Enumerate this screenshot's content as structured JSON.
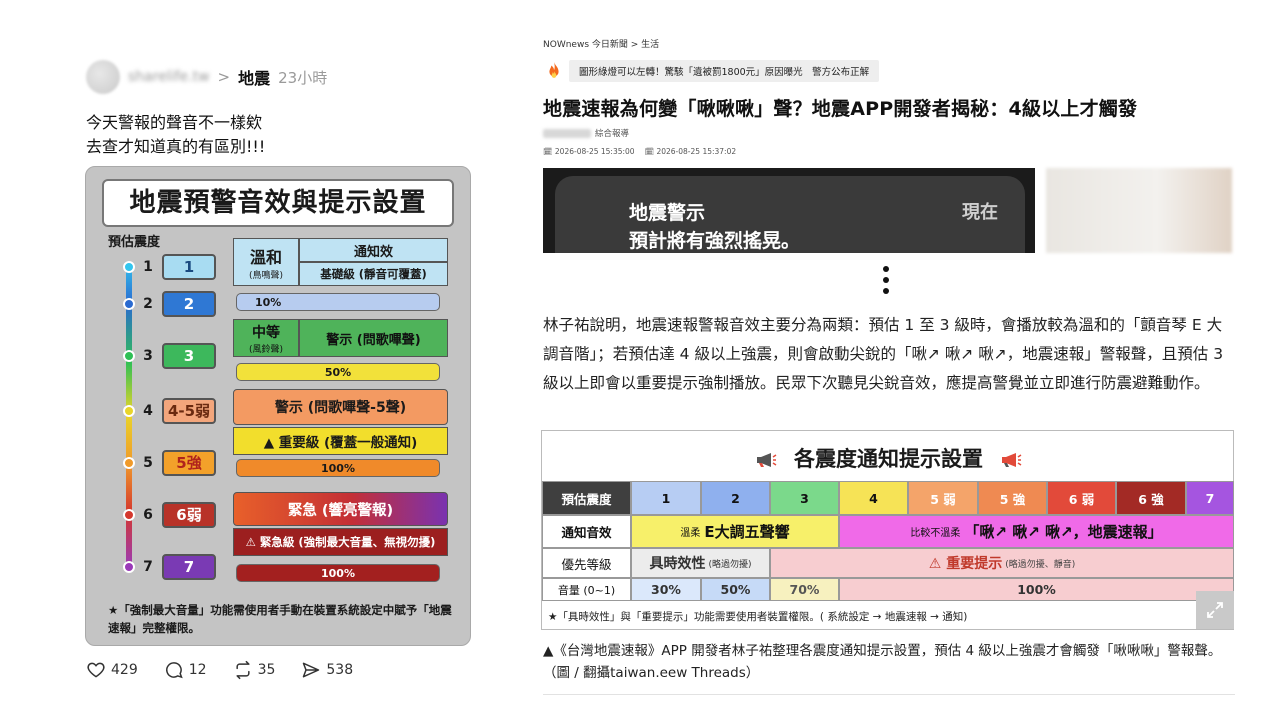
{
  "post": {
    "handle": "sharelife.tw",
    "separator": ">",
    "topic": "地震",
    "time_ago": "23小時",
    "text_line1": "今天警報的聲音不一樣欸",
    "text_line2": "去查才知道真的有區別!!!",
    "image": {
      "title": "地震預警音效與提示設置",
      "level_header": "預估震度",
      "levels": [
        {
          "num": "1",
          "label": "1",
          "color": "#a8dcf2",
          "text_color": "#1a4a80"
        },
        {
          "num": "2",
          "label": "2",
          "color": "#2f78d4",
          "text_color": "#ffffff"
        },
        {
          "num": "3",
          "label": "3",
          "color": "#3db85c",
          "text_color": "#ffffff"
        },
        {
          "num": "4",
          "label": "4-5弱",
          "color": "#f3a67c",
          "text_color": "#6a2a10"
        },
        {
          "num": "5",
          "label": "5強",
          "color": "#f3a12a",
          "text_color": "#b0231c"
        },
        {
          "num": "6",
          "label": "6弱",
          "color": "#b83228",
          "text_color": "#ffffff"
        },
        {
          "num": "7",
          "label": "7",
          "color": "#7a3ab4",
          "text_color": "#ffffff"
        }
      ],
      "gentle_label": "溫和",
      "gentle_sub": "(鳥鳴聲)",
      "notify_label": "通知效",
      "basic_level": "基礎級 (靜音可覆蓋)",
      "vol_10": "10%",
      "medium_label": "中等",
      "medium_sub": "(風鈴聲)",
      "warn_label": "警示 (問歌嗶聲)",
      "vol_50": "50%",
      "warn5_label": "警示 (問歌嗶聲-5聲)",
      "important_label": "▲ 重要級 (覆蓋一般通知)",
      "vol_100a": "100%",
      "urgent_label": "緊急 (響亮警報)",
      "urgent_level": "⚠ 緊急級 (強制最大音量、無視勿擾)",
      "vol_100b": "100%",
      "note": "★「強制最大音量」功能需使用者手動在裝置系統設定中賦予「地震速報」完整權限。"
    },
    "stats": {
      "likes": "429",
      "comments": "12",
      "reposts": "35",
      "shares": "538"
    }
  },
  "article": {
    "breadcrumb": "NOWnews 今日新聞 > 生活",
    "trending": "圖形綠燈可以左轉！驚駭「遺被罰1800元」原因曝光　警方公布正解",
    "headline": "地震速報為何變「啾啾啾」聲？地震APP開發者揭秘：4級以上才觸發",
    "author_role": "綜合報導",
    "published": "2026-08-25 15:35:00",
    "updated": "2026-08-25 15:37:02",
    "hero": {
      "line1": "地震警示",
      "line2": "預計將有強烈搖晃。",
      "now": "現在"
    },
    "body": "林子祐說明，地震速報警報音效主要分為兩類：預估 1 至 3 級時，會播放較為溫和的「顫音琴 E 大調音階」；若預估達 4 級以上強震，則會啟動尖銳的「啾↗ 啾↗ 啾↗，地震速報」警報聲，且預估 3 級以上即會以重要提示強制播放。民眾下次聽見尖銳音效，應提高警覺並立即進行防震避難動作。",
    "table": {
      "title": "各震度通知提示設置",
      "row_labels": [
        "預估震度",
        "通知音效",
        "優先等級",
        "音量 (0~1)"
      ],
      "levels": [
        {
          "label": "1",
          "color": "#b7cdf3"
        },
        {
          "label": "2",
          "color": "#8fb0ee"
        },
        {
          "label": "3",
          "color": "#7bd98b"
        },
        {
          "label": "4",
          "color": "#f6e356"
        },
        {
          "label": "5 弱",
          "color": "#f4a46a"
        },
        {
          "label": "5 強",
          "color": "#ef8a52"
        },
        {
          "label": "6 弱",
          "color": "#e24a3a"
        },
        {
          "label": "6 強",
          "color": "#a32a25"
        },
        {
          "label": "7",
          "color": "#a555e0"
        }
      ],
      "sound_gentle_prefix": "溫柔",
      "sound_gentle": "E大調五聲響",
      "sound_sharp_prefix": "比較不溫柔",
      "sound_sharp": "「啾↗ 啾↗ 啾↗，地震速報」",
      "priority_timely": "具時效性",
      "priority_timely_sub": "(略過勿擾)",
      "priority_important": "⚠ 重要提示",
      "priority_important_sub": "(略過勿擾、靜音)",
      "vol_30": "30%",
      "vol_50": "50%",
      "vol_70": "70%",
      "vol_100": "100%",
      "note": "★「具時效性」與「重要提示」功能需要使用者裝置權限。( 系統設定 → 地震速報 → 通知)"
    },
    "caption": "▲《台灣地震速報》APP 開發者林子祐整理各震度通知提示設置，預估 4 級以上強震才會觸發「啾啾啾」警報聲。（圖 / 翻攝taiwan.eew Threads）"
  }
}
